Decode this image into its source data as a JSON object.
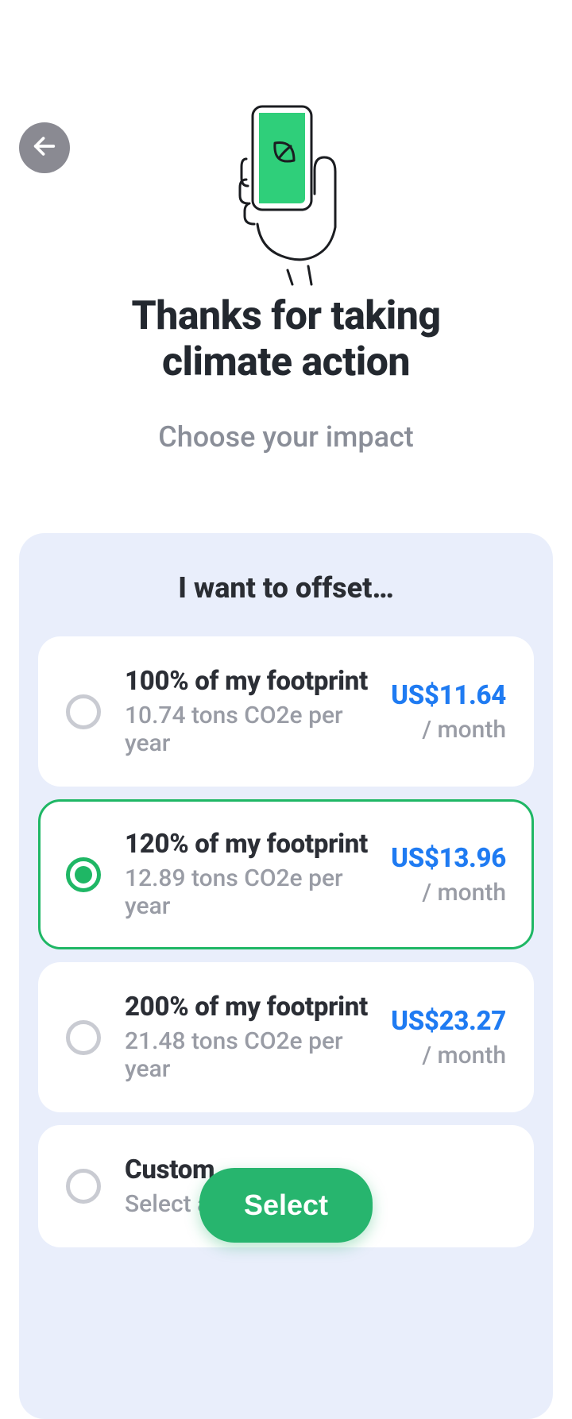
{
  "colors": {
    "accent": "#27b56e",
    "price": "#1f7bf2"
  },
  "header": {
    "title_line1": "Thanks for taking",
    "title_line2": "climate action",
    "subtitle": "Choose your impact"
  },
  "panel": {
    "heading": "I want to offset…"
  },
  "options": [
    {
      "title": "100% of my footprint",
      "sub": "10.74 tons CO2e per year",
      "price": "US$11.64",
      "per": "/ month",
      "selected": false
    },
    {
      "title": "120% of my footprint",
      "sub": "12.89 tons CO2e per year",
      "price": "US$13.96",
      "per": "/ month",
      "selected": true
    },
    {
      "title": "200% of my footprint",
      "sub": "21.48 tons CO2e per year",
      "price": "US$23.27",
      "per": "/ month",
      "selected": false
    },
    {
      "title": "Custom",
      "sub": "Select a",
      "price": "",
      "per": "",
      "selected": false
    }
  ],
  "cta": {
    "label": "Select"
  }
}
